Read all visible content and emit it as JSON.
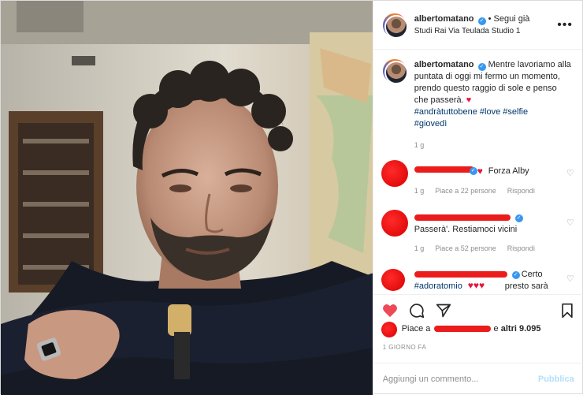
{
  "header": {
    "username": "albertomatano",
    "follow_label": "• Segui già",
    "location": "Studi Rai Via Teulada Studio 1",
    "more_label": "•••"
  },
  "caption": {
    "username": "albertomatano",
    "text": "Mentre lavoriamo alla puntata di oggi mi fermo un momento, prendo questo raggio di sole e penso che passerà.",
    "heart": "♥",
    "hashtags": [
      "#andràtuttobene",
      "#love",
      "#selfie",
      "#giovedì"
    ],
    "time": "1 g"
  },
  "comments": [
    {
      "text_prefix": "",
      "text": "Forza Alby",
      "time": "1 g",
      "likes": "Piace a 22 persone",
      "reply": "Rispondi"
    },
    {
      "text": "Passerà'. Restiamoci vicini",
      "time": "1 g",
      "likes": "Piace a 52 persone",
      "reply": "Rispondi"
    },
    {
      "text": "Certo",
      "tag": "#adoratomio",
      "text_after": "presto sarà",
      "hearts": "♥♥♥"
    }
  ],
  "likes": {
    "prefix": "Piace a",
    "suffix_pre": "e",
    "others": "altri 9.095"
  },
  "post_time": "1 GIORNO FA",
  "comment_box": {
    "placeholder": "Aggiungi un commento...",
    "publish": "Pubblica"
  },
  "icons": {
    "like": "heart-icon",
    "comment": "comment-icon",
    "share": "share-icon",
    "save": "bookmark-icon"
  },
  "colors": {
    "like_active": "#ed4956",
    "verified": "#3897f0",
    "hashtag": "#00376b",
    "publish_disabled": "#b2dffc"
  }
}
